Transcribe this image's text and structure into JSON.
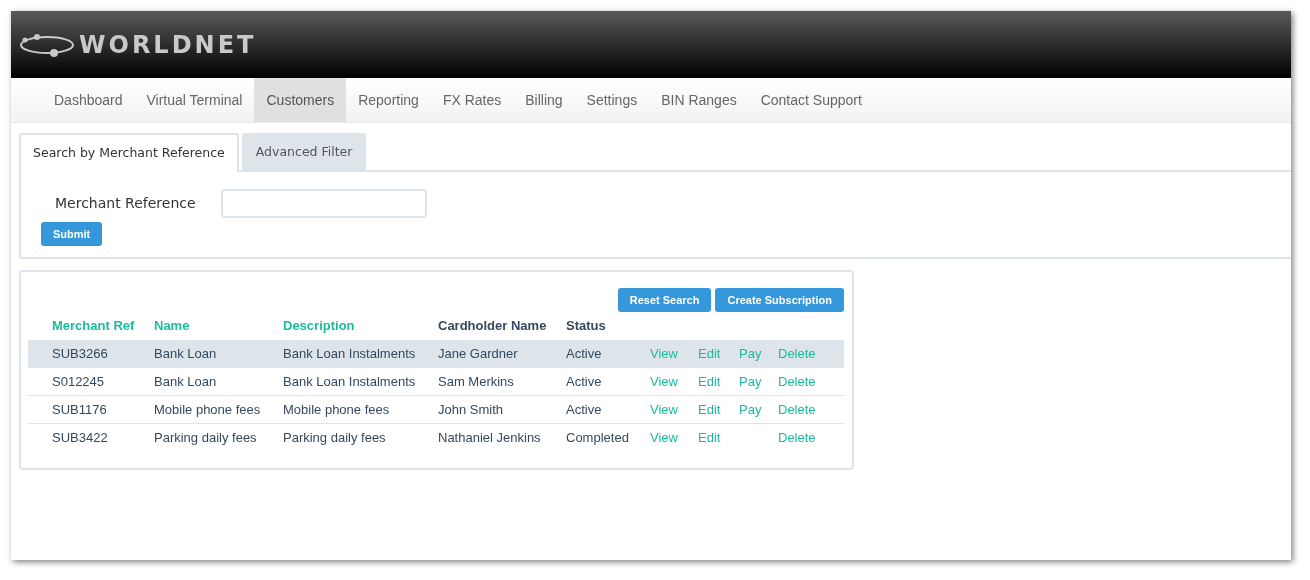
{
  "brand": {
    "name": "WORLDNET"
  },
  "nav": [
    {
      "label": "Dashboard",
      "selected": false
    },
    {
      "label": "Virtual Terminal",
      "selected": false
    },
    {
      "label": "Customers",
      "selected": true
    },
    {
      "label": "Reporting",
      "selected": false
    },
    {
      "label": "FX Rates",
      "selected": false
    },
    {
      "label": "Billing",
      "selected": false
    },
    {
      "label": "Settings",
      "selected": false
    },
    {
      "label": "BIN Ranges",
      "selected": false
    },
    {
      "label": "Contact Support",
      "selected": false
    }
  ],
  "tabs": [
    {
      "label": "Search by Merchant Reference",
      "selected": true
    },
    {
      "label": "Advanced Filter",
      "selected": false
    }
  ],
  "search": {
    "label": "Merchant Reference",
    "submit": "Submit"
  },
  "table_buttons": [
    "Reset Search",
    "Create Subscription"
  ],
  "table": {
    "columns": [
      {
        "label": "Merchant Ref",
        "sortable": true
      },
      {
        "label": "Name",
        "sortable": true
      },
      {
        "label": "Description",
        "sortable": true
      },
      {
        "label": "Cardholder Name",
        "sortable": false
      },
      {
        "label": "Status",
        "sortable": false
      }
    ],
    "rows": [
      {
        "cells": [
          "SUB3266",
          "Bank Loan",
          "Bank Loan Instalments",
          "Jane Gardner",
          "Active"
        ],
        "selected": true,
        "actions": {
          "view": "View",
          "edit": "Edit",
          "pay": "Pay",
          "delete": "Delete"
        }
      },
      {
        "cells": [
          "S012245",
          "Bank Loan",
          "Bank Loan Instalments",
          "Sam Merkins",
          "Active"
        ],
        "selected": false,
        "actions": {
          "view": "View",
          "edit": "Edit",
          "pay": "Pay",
          "delete": "Delete"
        }
      },
      {
        "cells": [
          "SUB1176",
          "Mobile phone fees",
          "Mobile phone fees",
          "John Smith",
          "Active"
        ],
        "selected": false,
        "actions": {
          "view": "View",
          "edit": "Edit",
          "pay": "Pay",
          "delete": "Delete"
        }
      },
      {
        "cells": [
          "SUB3422",
          "Parking daily fees",
          "Parking daily fees",
          "Nathaniel Jenkins",
          "Completed"
        ],
        "selected": false,
        "actions": {
          "view": "View",
          "edit": "Edit",
          "delete": "Delete"
        }
      }
    ]
  }
}
